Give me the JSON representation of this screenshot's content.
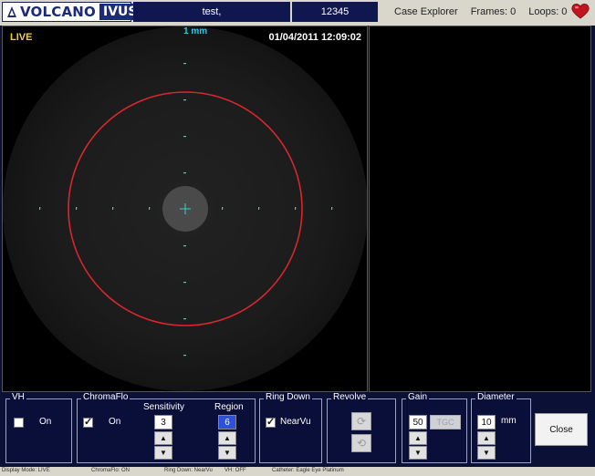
{
  "header": {
    "brand": "VOLCANO",
    "product": "IVUS",
    "patient_name": "test,",
    "patient_id": "12345",
    "case_explorer": "Case Explorer",
    "frames": "Frames: 0",
    "loops": "Loops: 0"
  },
  "image": {
    "mode_label": "LIVE",
    "scale_label": "1 mm",
    "datetime": "01/04/2011 12:09:02"
  },
  "controls": {
    "vh": {
      "title": "VH",
      "on_label": "On",
      "checked": false
    },
    "chromaflo": {
      "title": "ChromaFlo",
      "on_label": "On",
      "checked": true,
      "sensitivity_label": "Sensitivity",
      "sensitivity_value": "3",
      "region_label": "Region",
      "region_value": "6"
    },
    "ring_down": {
      "title": "Ring Down",
      "nearvu_label": "NearVu",
      "checked": true
    },
    "revolve": {
      "title": "Revolve"
    },
    "gain": {
      "title": "Gain",
      "value": "50",
      "tgc_label": "TGC"
    },
    "diameter": {
      "title": "Diameter",
      "value": "10",
      "unit": "mm"
    },
    "close_label": "Close"
  },
  "statusbar": {
    "display_mode": "Display Mode: LIVE",
    "chromaflo": "ChromaFlo: ON",
    "ring_down": "Ring Down: NearVu",
    "vh": "VH: OFF",
    "catheter": "Catheter: Eagle Eye Platinum"
  },
  "colors": {
    "vessel_ring": "#d8262e",
    "marker": "#3ad1c8",
    "live": "#f2d23c",
    "background": "#0b1036"
  }
}
